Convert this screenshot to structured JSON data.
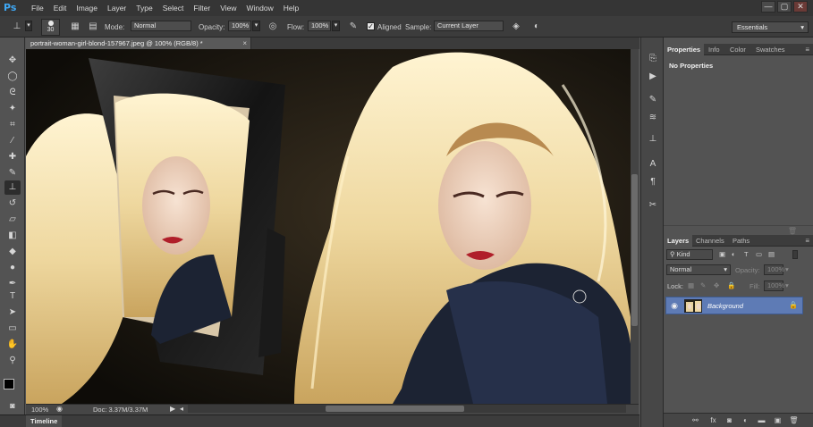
{
  "app": {
    "logo": "Ps"
  },
  "menu": [
    "File",
    "Edit",
    "Image",
    "Layer",
    "Type",
    "Select",
    "Filter",
    "View",
    "Window",
    "Help"
  ],
  "window_controls": [
    "—",
    "▢",
    "✕"
  ],
  "options": {
    "brush_size": "30",
    "mode_label": "Mode:",
    "mode_value": "Normal",
    "opacity_label": "Opacity:",
    "opacity_value": "100%",
    "flow_label": "Flow:",
    "flow_value": "100%",
    "aligned_label": "Aligned",
    "sample_label": "Sample:",
    "sample_value": "Current Layer"
  },
  "workspace": {
    "value": "Essentials"
  },
  "document": {
    "tab_title": "portrait-woman-girl-blond-157967.jpeg @ 100% (RGB/8) *",
    "close": "×",
    "zoom": "100%",
    "doc_info": "Doc: 3.37M/3.37M"
  },
  "timeline": {
    "label": "Timeline"
  },
  "properties": {
    "tabs": [
      "Properties",
      "Info",
      "Color",
      "Swatches"
    ],
    "empty_text": "No Properties"
  },
  "layers": {
    "tabs": [
      "Layers",
      "Channels",
      "Paths"
    ],
    "filter_kind": "Kind",
    "blend_mode": "Normal",
    "opacity_label": "Opacity:",
    "opacity_value": "100%",
    "lock_label": "Lock:",
    "fill_label": "Fill:",
    "fill_value": "100%",
    "items": [
      {
        "name": "Background",
        "visible": true,
        "locked": true
      }
    ]
  },
  "colors": {
    "ps_blue": "#3fa8f5",
    "selection": "#5e7bb5",
    "ui_dark": "#353535",
    "ui_mid": "#535353"
  },
  "icons": {
    "toolbar": [
      "move-icon",
      "marquee-icon",
      "lasso-icon",
      "quick-select-icon",
      "crop-icon",
      "eyedropper-icon",
      "healing-brush-icon",
      "brush-icon",
      "clone-stamp-icon",
      "history-brush-icon",
      "eraser-icon",
      "gradient-icon",
      "blur-icon",
      "dodge-icon",
      "pen-icon",
      "type-icon",
      "path-select-icon",
      "shape-icon",
      "hand-icon",
      "zoom-icon"
    ]
  }
}
